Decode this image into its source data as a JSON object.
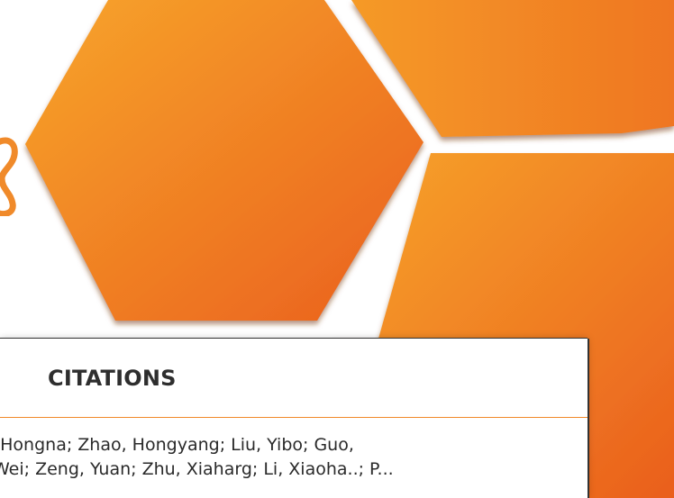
{
  "citations_panel": {
    "title": "CITATIONS",
    "lines": [
      "g, Hongna; Zhao, Hongyang; Liu, Yibo; Guo,",
      "Wei; Zeng, Yuan; Zhu, Xiaharg; Li, Xiaoha..; P..."
    ]
  },
  "colors": {
    "accent_orange": "#f08a2a",
    "hex_dark": "#e8621f",
    "hex_light": "#f6a12a"
  }
}
